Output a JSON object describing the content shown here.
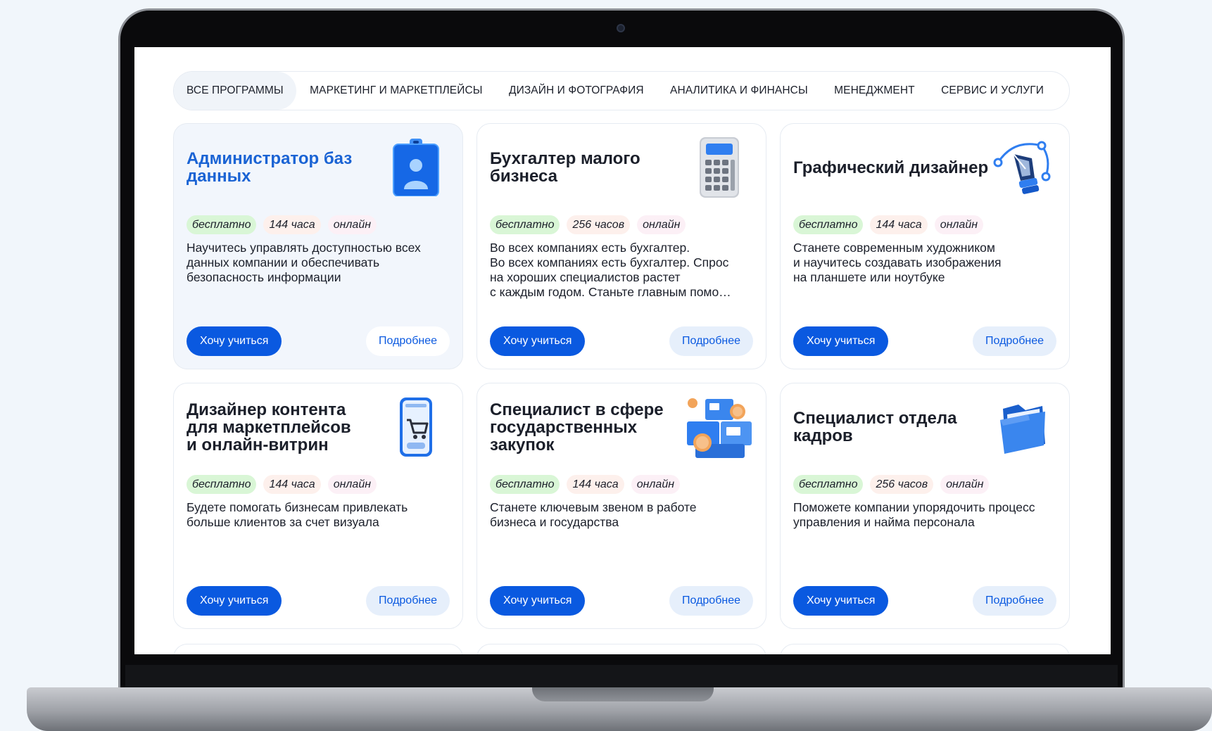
{
  "tabs": [
    {
      "label": "ВСЕ ПРОГРАММЫ",
      "active": true
    },
    {
      "label": "МАРКЕТИНГ И МАРКЕТПЛЕЙСЫ"
    },
    {
      "label": "ДИЗАЙН И ФОТОГРАФИЯ"
    },
    {
      "label": "АНАЛИТИКА И ФИНАНСЫ"
    },
    {
      "label": "МЕНЕДЖМЕНТ"
    },
    {
      "label": "СЕРВИС И УСЛУГИ"
    }
  ],
  "buttons": {
    "enroll": "Хочу учиться",
    "more": "Подробнее"
  },
  "cards": [
    {
      "title": "Администратор баз\nданных",
      "icon": "id-badge-icon",
      "tags": [
        "бесплатно",
        "144 часа",
        "онлайн"
      ],
      "desc": "Научитесь управлять доступностью всех\nданных компании и обеспечивать\nбезопасность информации"
    },
    {
      "title": "Бухгалтер малого\nбизнеса",
      "icon": "calculator-icon",
      "tags": [
        "бесплатно",
        "256 часов",
        "онлайн"
      ],
      "desc": "Во всех компаниях есть бухгалтер.\nВо всех компаниях есть бухгалтер. Спрос\nна хороших специалистов растет\nс каждым годом. Станьте главным помо…"
    },
    {
      "title": "Графический дизайнер",
      "icon": "pen-tool-icon",
      "tags": [
        "бесплатно",
        "144 часа",
        "онлайн"
      ],
      "desc": "Станете современным художником\nи научитесь создавать изображения\nна планшете или ноутбуке"
    },
    {
      "title": "Дизайнер контента\nдля маркетплейсов\nи онлайн-витрин",
      "icon": "phone-cart-icon",
      "tags": [
        "бесплатно",
        "144 часа",
        "онлайн"
      ],
      "desc": "Будете помогать бизнесам привлекать\nбольше клиентов за счет визуала"
    },
    {
      "title": "Специалист в сфере\nгосударственных\nзакупок",
      "icon": "boxes-coins-icon",
      "tags": [
        "бесплатно",
        "144 часа",
        "онлайн"
      ],
      "desc": "Станете ключевым звеном в работе\nбизнеса и государства"
    },
    {
      "title": "Специалист отдела\nкадров",
      "icon": "folder-icon",
      "tags": [
        "бесплатно",
        "256 часов",
        "онлайн"
      ],
      "desc": "Поможете компании упорядочить процесс\nуправления и найма персонала"
    }
  ]
}
